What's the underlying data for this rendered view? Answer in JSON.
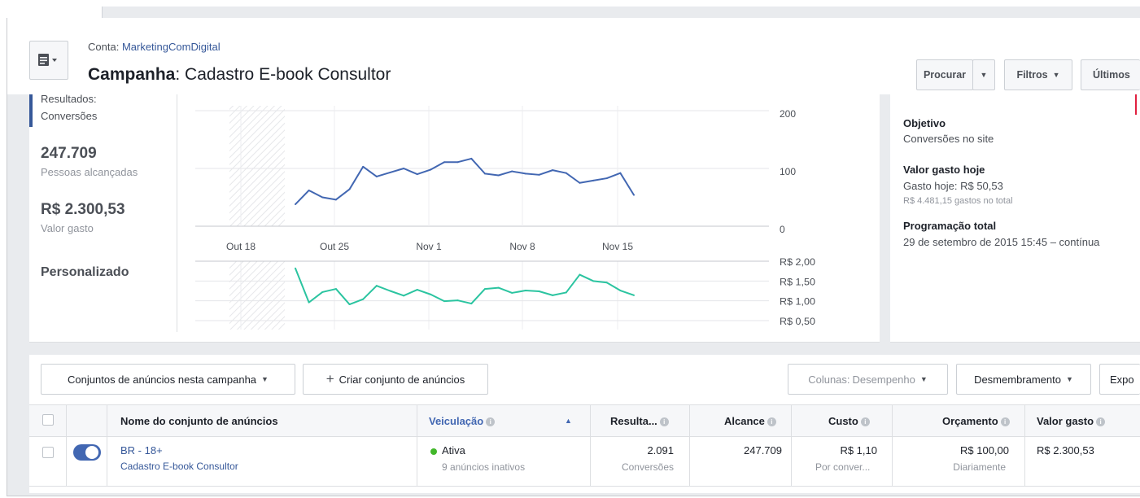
{
  "header": {
    "account_prefix": "Conta:",
    "account_name": "MarketingComDigital",
    "campaign_prefix": "Campanha",
    "campaign_name": ": Cadastro E-book Consultor",
    "buttons": {
      "search": "Procurar",
      "filters": "Filtros",
      "last": "Últimos"
    }
  },
  "summary": {
    "results_label": "Resultados:",
    "results_type": "Conversões",
    "reach_value": "247.709",
    "reach_label": "Pessoas alcançadas",
    "spent_value": "R$ 2.300,53",
    "spent_label": "Valor gasto",
    "custom_label": "Personalizado"
  },
  "details": {
    "objective_title": "Objetivo",
    "objective_value": "Conversões no site",
    "spent_today_title": "Valor gasto hoje",
    "spent_today_value": "Gasto hoje: R$ 50,53",
    "spent_total": "R$ 4.481,15 gastos no total",
    "schedule_title": "Programação total",
    "schedule_value": "29 de setembro de 2015 15:45 – contínua"
  },
  "chart_data": [
    {
      "type": "line",
      "x_ticks": [
        "Out 18",
        "Out 25",
        "Nov 1",
        "Nov 8",
        "Nov 15"
      ],
      "y_ticks": [
        "200",
        "100",
        "0"
      ],
      "ylim": [
        0,
        200
      ],
      "colors": {
        "line": "#4267b2"
      },
      "values": [
        38,
        62,
        50,
        46,
        64,
        103,
        86,
        93,
        100,
        90,
        98,
        111,
        111,
        117,
        91,
        88,
        95,
        91,
        89,
        97,
        92,
        75,
        79,
        83,
        92,
        54
      ]
    },
    {
      "type": "line",
      "y_ticks": [
        "R$ 2,00",
        "R$ 1,50",
        "R$ 1,00",
        "R$ 0,50"
      ],
      "ylim": [
        0.5,
        2.0
      ],
      "colors": {
        "line": "#2bc4a0"
      },
      "values": [
        1.82,
        0.96,
        1.22,
        1.3,
        0.91,
        1.04,
        1.38,
        1.25,
        1.13,
        1.28,
        1.16,
        0.99,
        1.01,
        0.93,
        1.3,
        1.33,
        1.2,
        1.26,
        1.24,
        1.14,
        1.21,
        1.66,
        1.5,
        1.46,
        1.26,
        1.14
      ]
    }
  ],
  "toolbar": {
    "adsets_dropdown": "Conjuntos de anúncios nesta campanha",
    "create_adset": "Criar conjunto de anúncios",
    "columns_prefix": "Colunas:",
    "columns_value": "Desempenho",
    "breakdown": "Desmembramento",
    "export": "Expo"
  },
  "table": {
    "headers": {
      "name": "Nome do conjunto de anúncios",
      "delivery": "Veiculação",
      "results": "Resulta...",
      "reach": "Alcance",
      "cost": "Custo",
      "budget": "Orçamento",
      "spent": "Valor gasto"
    },
    "row": {
      "name": "BR - 18+",
      "campaign": "Cadastro E-book Consultor",
      "delivery": "Ativa",
      "delivery_sub": "9 anúncios inativos",
      "results": "2.091",
      "results_sub": "Conversões",
      "reach": "247.709",
      "cost": "R$ 1,10",
      "cost_sub": "Por conver...",
      "budget": "R$ 100,00",
      "budget_sub": "Diariamente",
      "spent": "R$ 2.300,53"
    }
  }
}
